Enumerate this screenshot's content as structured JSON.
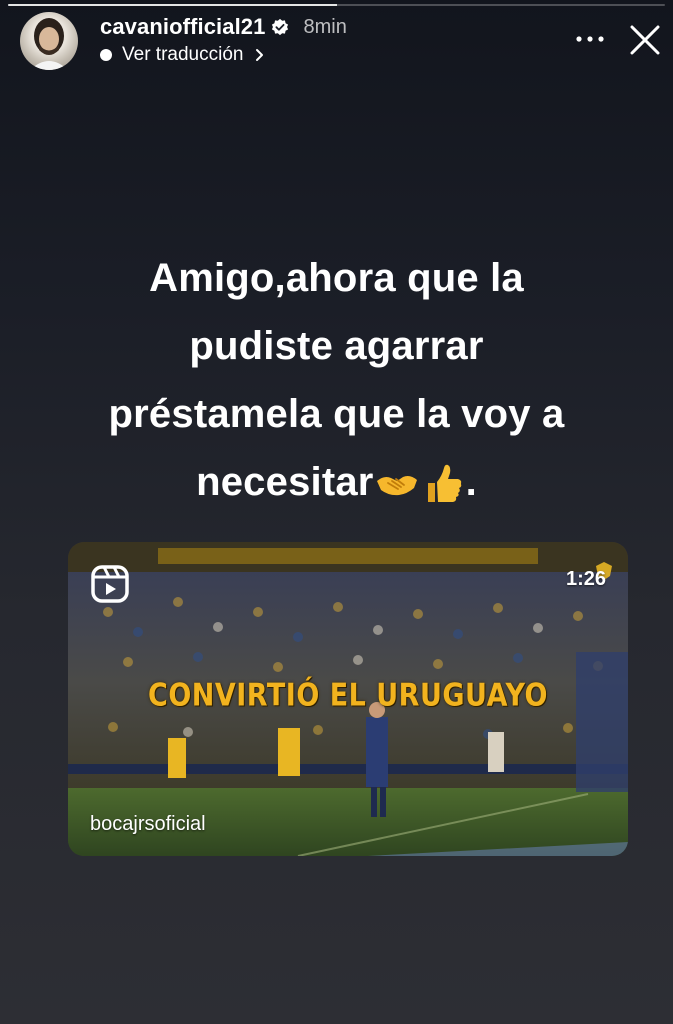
{
  "header": {
    "username": "cavaniofficial21",
    "timestamp": "8min",
    "translate_label": "Ver traducción",
    "verified_icon": "verified-badge-icon",
    "more_icon": "more-horizontal-icon",
    "close_icon": "close-icon"
  },
  "progress": {
    "fraction": 0.5
  },
  "story": {
    "text_lines": [
      "Amigo,ahora que la",
      "pudiste agarrar",
      "préstamela que la voy a",
      "necesitar"
    ],
    "trailing_emojis": [
      "handshake-emoji",
      "thumbs-up-emoji"
    ],
    "trailing_punct": "."
  },
  "reel": {
    "overlay_text": "CONVIRTIÓ EL URUGUAYO",
    "duration": "1:26",
    "author": "bocajrsoficial",
    "icon": "reels-icon",
    "colors": {
      "accent": "#f2b31e"
    }
  }
}
